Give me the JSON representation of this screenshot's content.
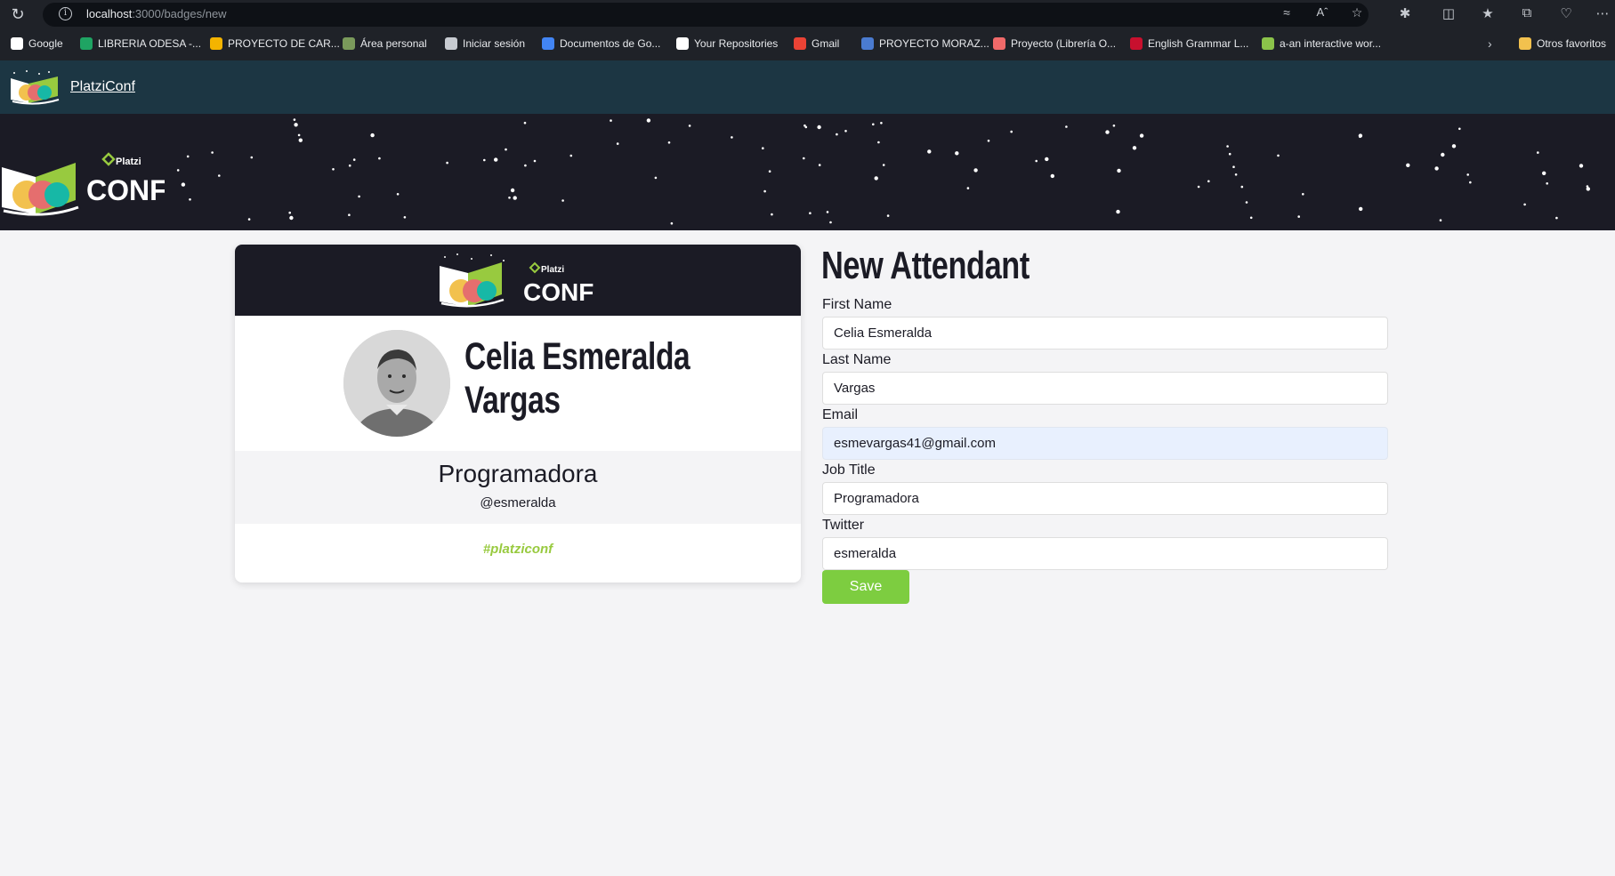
{
  "browser": {
    "url_host": "localhost",
    "url_path": ":3000/badges/new",
    "bookmarks": [
      {
        "label": "Google",
        "icon": "google-icon",
        "color": "#ffffff"
      },
      {
        "label": "LIBRERIA ODESA -...",
        "icon": "sheets-icon",
        "color": "#1fa463"
      },
      {
        "label": "PROYECTO DE CAR...",
        "icon": "drive-icon",
        "color": "#f4b400"
      },
      {
        "label": "Área personal",
        "icon": "moodle-icon",
        "color": "#7a9a5b"
      },
      {
        "label": "Iniciar sesión",
        "icon": "page-icon",
        "color": "#c7cbd1"
      },
      {
        "label": "Documentos de Go...",
        "icon": "docs-icon",
        "color": "#4285f4"
      },
      {
        "label": "Your Repositories",
        "icon": "github-icon",
        "color": "#ffffff"
      },
      {
        "label": "Gmail",
        "icon": "gmail-icon",
        "color": "#ea4335"
      },
      {
        "label": "PROYECTO MORAZ...",
        "icon": "azure-icon",
        "color": "#4a7bd0"
      },
      {
        "label": "Proyecto (Librería O...",
        "icon": "asana-icon",
        "color": "#f06a6a"
      },
      {
        "label": "English Grammar L...",
        "icon": "uk-flag-icon",
        "color": "#c8102e"
      },
      {
        "label": "a-an interactive wor...",
        "icon": "worksheet-icon",
        "color": "#8bc34a"
      }
    ],
    "other_favorites": "Otros favoritos"
  },
  "navbar": {
    "brand": "PlatziConf"
  },
  "badge": {
    "first_name": "Celia Esmeralda",
    "last_name": "Vargas",
    "job_title": "Programadora",
    "twitter_handle": "@esmeralda",
    "hashtag": "#platziconf"
  },
  "form": {
    "title": "New Attendant",
    "first_name_label": "First Name",
    "first_name_value": "Celia Esmeralda",
    "last_name_label": "Last Name",
    "last_name_value": "Vargas",
    "email_label": "Email",
    "email_value": "esmevargas41@gmail.com",
    "job_title_label": "Job Title",
    "job_title_value": "Programadora",
    "twitter_label": "Twitter",
    "twitter_value": "esmeralda",
    "save_label": "Save"
  },
  "logo": {
    "small_word": "Platzi",
    "big_word": "CONF"
  },
  "colors": {
    "brand_dark": "#1b1b25",
    "navbar": "#1c3643",
    "accent_green": "#7dcd40",
    "hashtag_green": "#98ca3f"
  }
}
